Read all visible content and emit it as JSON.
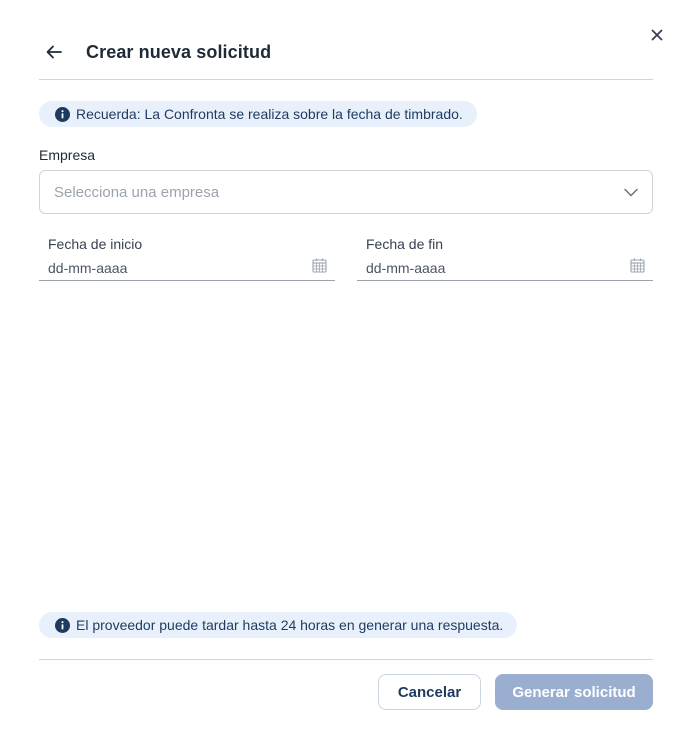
{
  "dialog": {
    "title": "Crear nueva solicitud"
  },
  "notice_top": {
    "text": "Recuerda: La Confronta se realiza sobre la fecha de timbrado."
  },
  "company": {
    "label": "Empresa",
    "placeholder": "Selecciona una empresa"
  },
  "start_date": {
    "label": "Fecha de inicio",
    "placeholder": "dd-mm-aaaa"
  },
  "end_date": {
    "label": "Fecha de fin",
    "placeholder": "dd-mm-aaaa"
  },
  "notice_bottom": {
    "text": "El proveedor puede tardar hasta 24 horas en generar una respuesta."
  },
  "actions": {
    "cancel_label": "Cancelar",
    "submit_label": "Generar solicitud"
  },
  "colors": {
    "notice_bg": "#e8f1fb",
    "info_icon": "#1e3a5f",
    "primary_disabled": "#9aafcf",
    "text_dark": "#1f2a37"
  },
  "icons": {
    "close": "close-icon",
    "back": "arrow-left-icon",
    "info": "info-icon",
    "dropdown": "chevron-down-icon",
    "calendar": "calendar-icon"
  }
}
